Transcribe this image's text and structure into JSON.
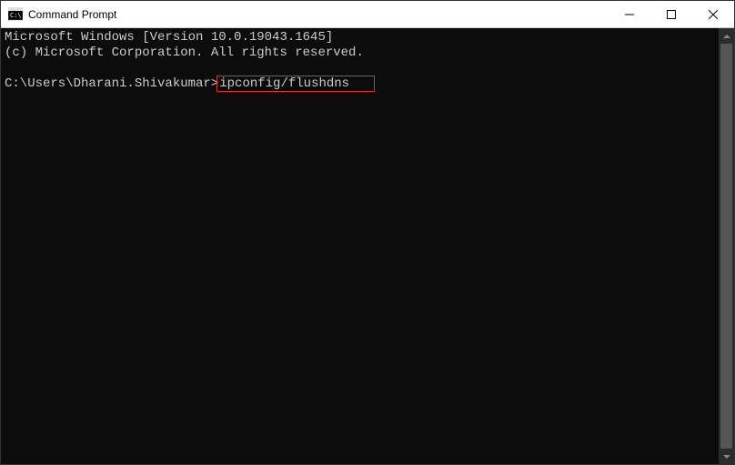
{
  "window": {
    "title": "Command Prompt"
  },
  "terminal": {
    "line1": "Microsoft Windows [Version 10.0.19043.1645]",
    "line2": "(c) Microsoft Corporation. All rights reserved.",
    "blank": "",
    "prompt": "C:\\Users\\Dharani.Shivakumar>",
    "command": "ipconfig/flushdns"
  }
}
